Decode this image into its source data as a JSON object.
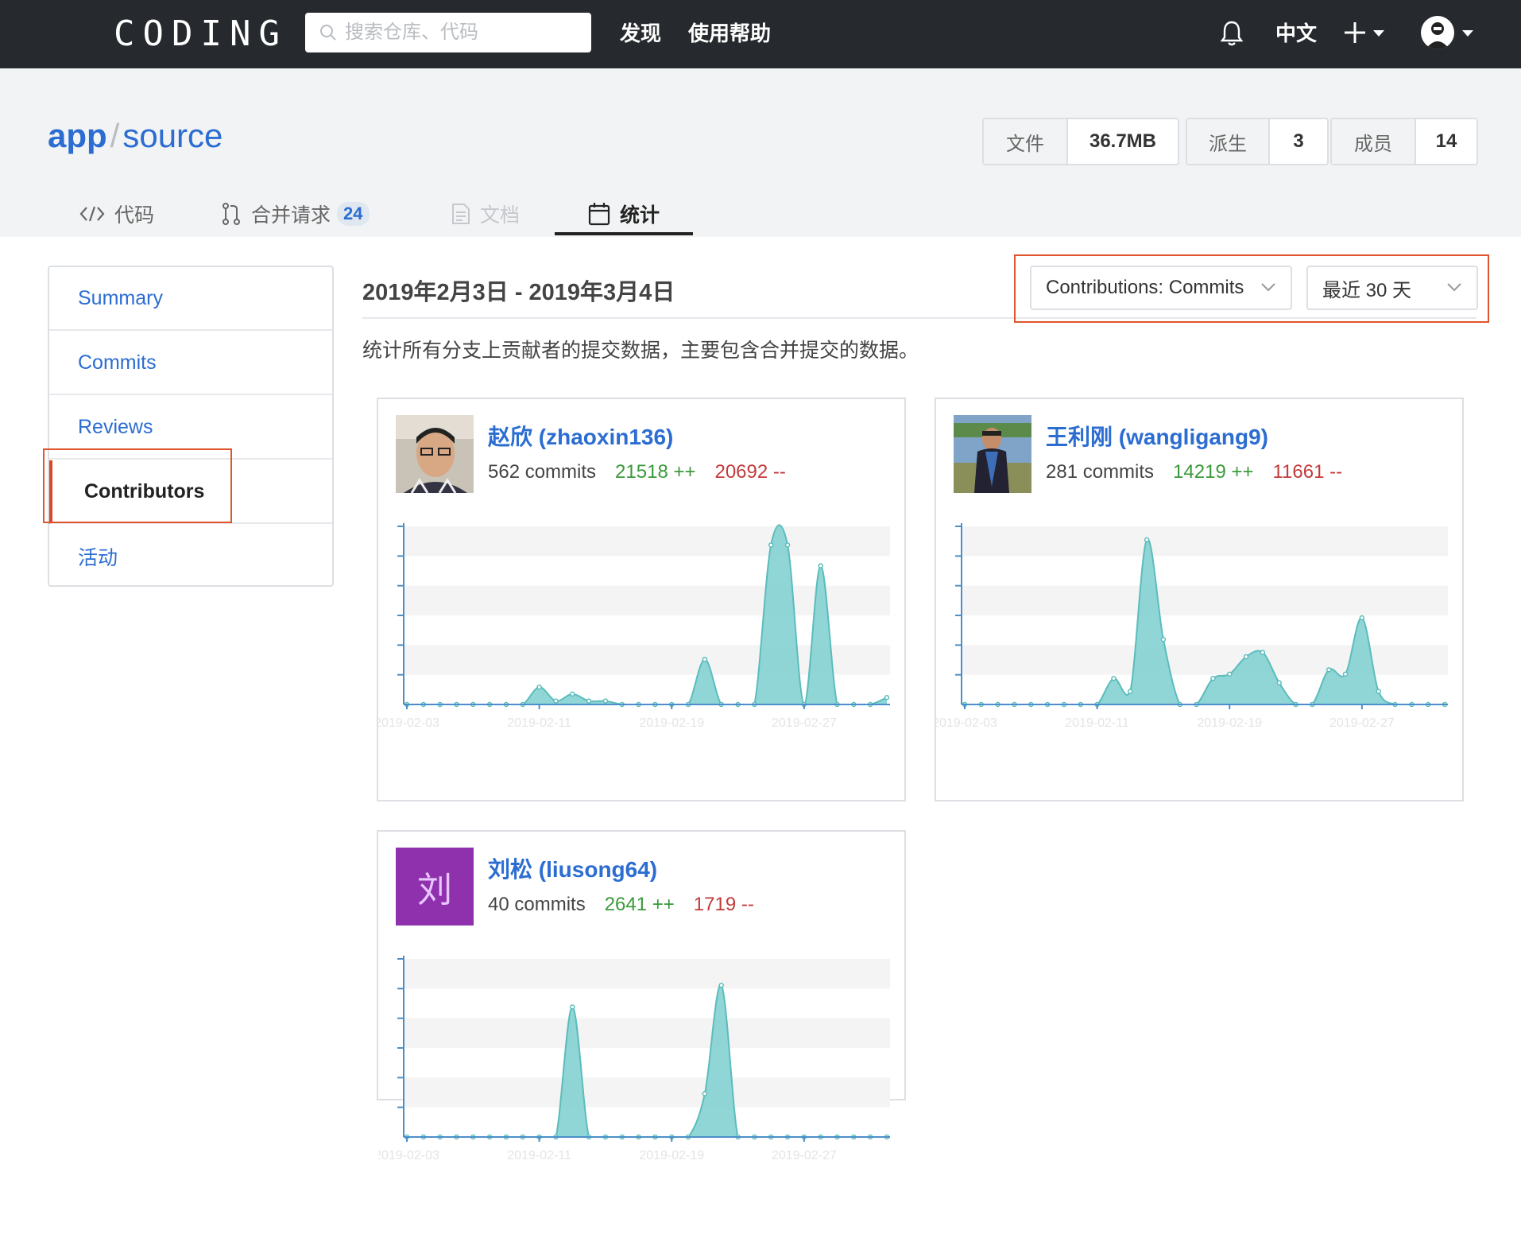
{
  "topbar": {
    "logo": "CODING",
    "search_placeholder": "搜索仓库、代码",
    "nav": [
      "发现",
      "使用帮助"
    ],
    "lang": "中文",
    "icons": [
      "bell-icon",
      "plus-icon",
      "avatar"
    ]
  },
  "repo": {
    "owner": "app",
    "separator": "/",
    "name": "source",
    "stats": [
      {
        "label": "文件",
        "value": "36.7MB"
      },
      {
        "label": "派生",
        "value": "3"
      },
      {
        "label": "成员",
        "value": "14"
      }
    ]
  },
  "tabs": [
    {
      "label": "代码",
      "icon": "code-icon"
    },
    {
      "label": "合并请求",
      "icon": "merge-request-icon",
      "badge": "24"
    },
    {
      "label": "文档",
      "icon": "document-icon",
      "disabled": true
    },
    {
      "label": "统计",
      "icon": "calendar-icon",
      "active": true
    }
  ],
  "sidebar": {
    "items": [
      "Summary",
      "Commits",
      "Reviews",
      "Contributors",
      "活动"
    ],
    "active": "Contributors"
  },
  "main": {
    "date_range": "2019年2月3日 - 2019年3月4日",
    "description": "统计所有分支上贡献者的提交数据，主要包含合并提交的数据。",
    "filter_type": "Contributions: Commits",
    "filter_period": "最近 30 天"
  },
  "contributors": [
    {
      "name": "赵欣 (zhaoxin136)",
      "commits": "562 commits",
      "additions": "21518 ++",
      "deletions": "20692 --",
      "avatar": "photo"
    },
    {
      "name": "王利刚 (wangligang9)",
      "commits": "281 commits",
      "additions": "14219 ++",
      "deletions": "11661 --",
      "avatar": "photo"
    },
    {
      "name": "刘松 (liusong64)",
      "commits": "40 commits",
      "additions": "2641 ++",
      "deletions": "1719 --",
      "avatar": "letter",
      "avatar_letter": "刘",
      "avatar_color": "#8f30ac"
    }
  ],
  "chart_data": [
    {
      "type": "area",
      "x_ticks": [
        "2019-02-03",
        "2019-02-11",
        "2019-02-19",
        "2019-02-27"
      ],
      "series": [
        {
          "values": [
            0,
            0,
            0,
            0,
            0,
            0,
            0,
            0,
            5,
            1,
            3,
            1,
            1,
            0,
            0,
            0,
            0,
            0,
            13,
            0,
            0,
            0,
            46,
            46,
            0,
            40,
            0,
            0,
            0,
            2
          ]
        }
      ],
      "ylim": [
        0,
        50
      ]
    },
    {
      "type": "area",
      "x_ticks": [
        "2019-02-03",
        "2019-02-11",
        "2019-02-19",
        "2019-02-27"
      ],
      "series": [
        {
          "values": [
            0,
            0,
            0,
            0,
            0,
            0,
            0,
            0,
            0,
            6,
            3,
            38,
            15,
            0,
            0,
            6,
            7,
            11,
            12,
            5,
            0,
            0,
            8,
            7,
            20,
            3,
            0,
            0,
            0,
            0
          ]
        }
      ],
      "ylim": [
        0,
        40
      ]
    },
    {
      "type": "area",
      "x_ticks": [
        "2019-02-03",
        "2019-02-11",
        "2019-02-19",
        "2019-02-27"
      ],
      "series": [
        {
          "values": [
            0,
            0,
            0,
            0,
            0,
            0,
            0,
            0,
            0,
            0,
            6,
            0,
            0,
            0,
            0,
            0,
            0,
            0,
            2,
            7,
            0,
            0,
            0,
            0,
            0,
            0,
            0,
            0,
            0,
            0
          ]
        }
      ],
      "ylim": [
        0,
        8
      ]
    }
  ],
  "colors": {
    "accent": "#2b6dd1",
    "topbar": "#26292d",
    "chart_fill": "#7ccfcf",
    "additions": "#3a9a3a",
    "deletions": "#c33a3a",
    "highlight": "#e0542f"
  }
}
